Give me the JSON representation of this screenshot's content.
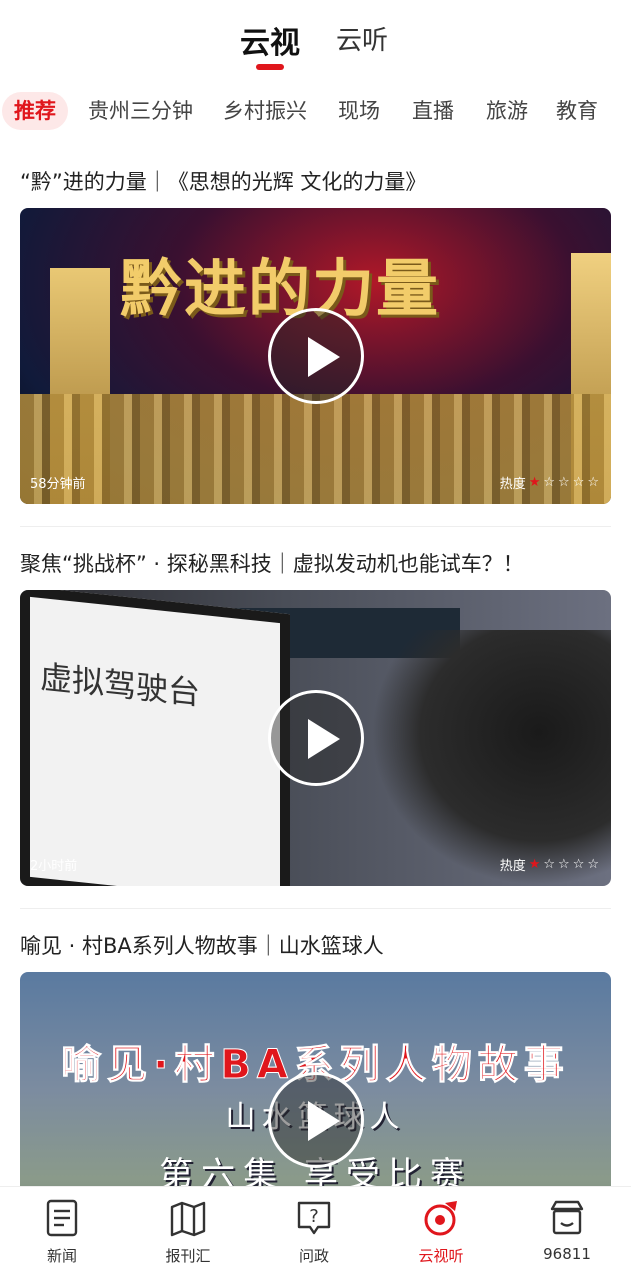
{
  "top_tabs": [
    {
      "label": "云视",
      "active": true
    },
    {
      "label": "云听",
      "active": false
    }
  ],
  "categories": [
    "推荐",
    "贵州三分钟",
    "乡村振兴",
    "现场",
    "直播",
    "旅游",
    "教育"
  ],
  "feed": [
    {
      "title": "“黔”进的力量｜《思想的光辉  文化的力量》",
      "thumbnail_text": "黔进的力量",
      "time": "58分钟前",
      "heat_label": "热度",
      "heat_stars": 1,
      "heat_max": 5
    },
    {
      "title": "聚焦“挑战杯” · 探秘黑科技｜虚拟发动机也能试车？！",
      "thumbnail_text": "虚拟驾驶台",
      "time": "2小时前",
      "heat_label": "热度",
      "heat_stars": 1,
      "heat_max": 5
    },
    {
      "title": "喻见 · 村BA系列人物故事｜山水篮球人",
      "thumbnail_lines": [
        "喻见·村BA系列人物故事",
        "山水篮球人",
        "第六集  享受比赛"
      ]
    }
  ],
  "bottom_nav": [
    {
      "label": "新闻",
      "icon": "document-icon",
      "active": false
    },
    {
      "label": "报刊汇",
      "icon": "map-book-icon",
      "active": false
    },
    {
      "label": "问政",
      "icon": "question-bubble-icon",
      "active": false
    },
    {
      "label": "云视听",
      "icon": "media-disc-icon",
      "active": true
    },
    {
      "label": "96811",
      "icon": "store-icon",
      "active": false
    }
  ],
  "colors": {
    "accent": "#e0161c",
    "text": "#222222"
  }
}
